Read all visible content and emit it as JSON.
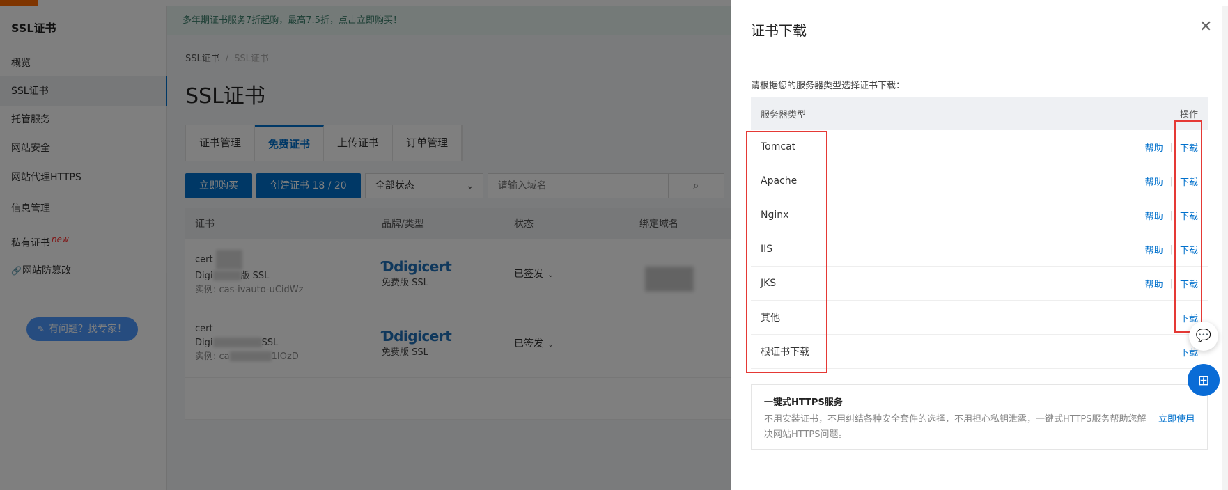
{
  "sidebar": {
    "title": "SSL证书",
    "items": [
      {
        "label": "概览"
      },
      {
        "label": "SSL证书"
      },
      {
        "label": "托管服务"
      },
      {
        "label": "网站安全"
      },
      {
        "label": "网站代理HTTPS"
      },
      {
        "label": "信息管理"
      },
      {
        "label": "私有证书",
        "badge": "new"
      },
      {
        "label": "网站防篡改"
      }
    ],
    "help_button": "有问题？找专家！"
  },
  "notice": "多年期证书服务7折起购，最高7.5折，点击立即购买！",
  "breadcrumb": {
    "root": "SSL证书",
    "current": "SSL证书"
  },
  "page_title": "SSL证书",
  "tabs": [
    {
      "label": "证书管理"
    },
    {
      "label": "免费证书"
    },
    {
      "label": "上传证书"
    },
    {
      "label": "订单管理"
    }
  ],
  "toolbar": {
    "buy_button": "立即购买",
    "create_button": "创建证书 18 / 20",
    "status_select": "全部状态",
    "search_placeholder": "请输入域名"
  },
  "table": {
    "headers": [
      "证书",
      "品牌/类型",
      "状态",
      "绑定域名"
    ],
    "rows": [
      {
        "name": "cert",
        "product_prefix": "Digi",
        "product_suffix": "版 SSL",
        "instance": "实例: cas-ivauto-uCidWz",
        "brand": "digicert",
        "type": "免费版 SSL",
        "status": "已签发"
      },
      {
        "name": "cert",
        "product_prefix": "Digi",
        "product_suffix": "SSL",
        "instance_prefix": "实例: ca",
        "instance_suffix": "1IOzD",
        "brand": "digicert",
        "type": "免费版 SSL",
        "status": "已签发"
      }
    ]
  },
  "drawer": {
    "title": "证书下载",
    "hint": "请根据您的服务器类型选择证书下载：",
    "col_server": "服务器类型",
    "col_ops": "操作",
    "help_label": "帮助",
    "download_label": "下载",
    "servers": [
      {
        "name": "Tomcat"
      },
      {
        "name": "Apache"
      },
      {
        "name": "Nginx"
      },
      {
        "name": "IIS"
      },
      {
        "name": "JKS"
      },
      {
        "name": "其他"
      },
      {
        "name": "根证书下载"
      }
    ],
    "https": {
      "title": "一键式HTTPS服务",
      "desc": "不用安装证书，不用纠结各种安全套件的选择，不用担心私钥泄露，一键式HTTPS服务帮助您解决网站HTTPS问题。",
      "link": "立即使用"
    }
  },
  "colors": {
    "accent": "#0070cc",
    "brand_orange": "#ff6a00",
    "highlight_red": "#e53935"
  }
}
